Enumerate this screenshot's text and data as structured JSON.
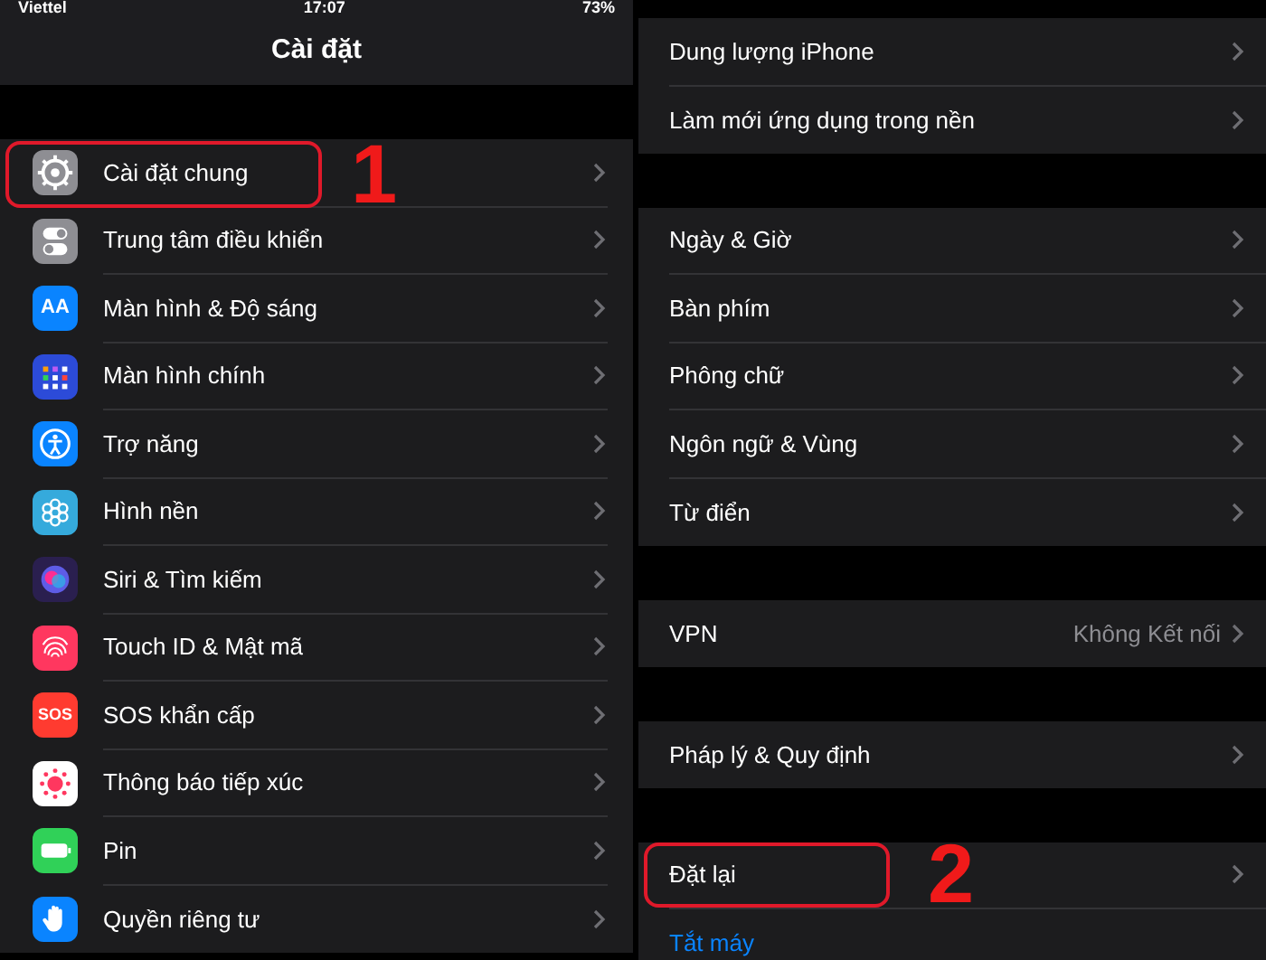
{
  "status_bar": {
    "carrier": "Viettel",
    "time": "17:07",
    "battery": "73%"
  },
  "nav": {
    "title": "Cài đặt"
  },
  "settings": [
    {
      "label": "Cài đặt chung",
      "color": "#8e8e93",
      "highlighted": true,
      "annotation": "1"
    },
    {
      "label": "Trung tâm điều khiển",
      "color": "#8e8e93",
      "highlighted": false
    },
    {
      "label": "Màn hình & Độ sáng",
      "color": "#0a84ff",
      "highlighted": false,
      "icon_text": "AA"
    },
    {
      "label": "Màn hình chính",
      "color": "#2c4bd8",
      "highlighted": false
    },
    {
      "label": "Trợ năng",
      "color": "#0a84ff",
      "highlighted": false
    },
    {
      "label": "Hình nền",
      "color": "#35aadc",
      "highlighted": false
    },
    {
      "label": "Siri & Tìm kiếm",
      "color": "#2a1f4f",
      "highlighted": false
    },
    {
      "label": "Touch ID & Mật mã",
      "color": "#ff375f",
      "highlighted": false
    },
    {
      "label": "SOS khẩn cấp",
      "color": "#ff3b30",
      "highlighted": false,
      "icon_text": "SOS"
    },
    {
      "label": "Thông báo tiếp xúc",
      "color": "#ffffff",
      "highlighted": false
    },
    {
      "label": "Pin",
      "color": "#30d158",
      "highlighted": false
    },
    {
      "label": "Quyền riêng tư",
      "color": "#0a84ff",
      "highlighted": false
    }
  ],
  "general_groups": [
    [
      {
        "label": "Dung lượng iPhone",
        "highlighted": false
      },
      {
        "label": "Làm mới ứng dụng trong nền",
        "highlighted": false
      }
    ],
    [
      {
        "label": "Ngày & Giờ",
        "highlighted": false
      },
      {
        "label": "Bàn phím",
        "highlighted": false
      },
      {
        "label": "Phông chữ",
        "highlighted": false
      },
      {
        "label": "Ngôn ngữ & Vùng",
        "highlighted": false
      },
      {
        "label": "Từ điển",
        "highlighted": false
      }
    ],
    [
      {
        "label": "VPN",
        "value": "Không Kết nối",
        "highlighted": false
      }
    ],
    [
      {
        "label": "Pháp lý & Quy định",
        "highlighted": false
      }
    ],
    [
      {
        "label": "Đặt lại",
        "highlighted": true,
        "annotation": "2"
      },
      {
        "label": "Tắt máy",
        "kind": "link",
        "highlighted": false
      }
    ]
  ]
}
